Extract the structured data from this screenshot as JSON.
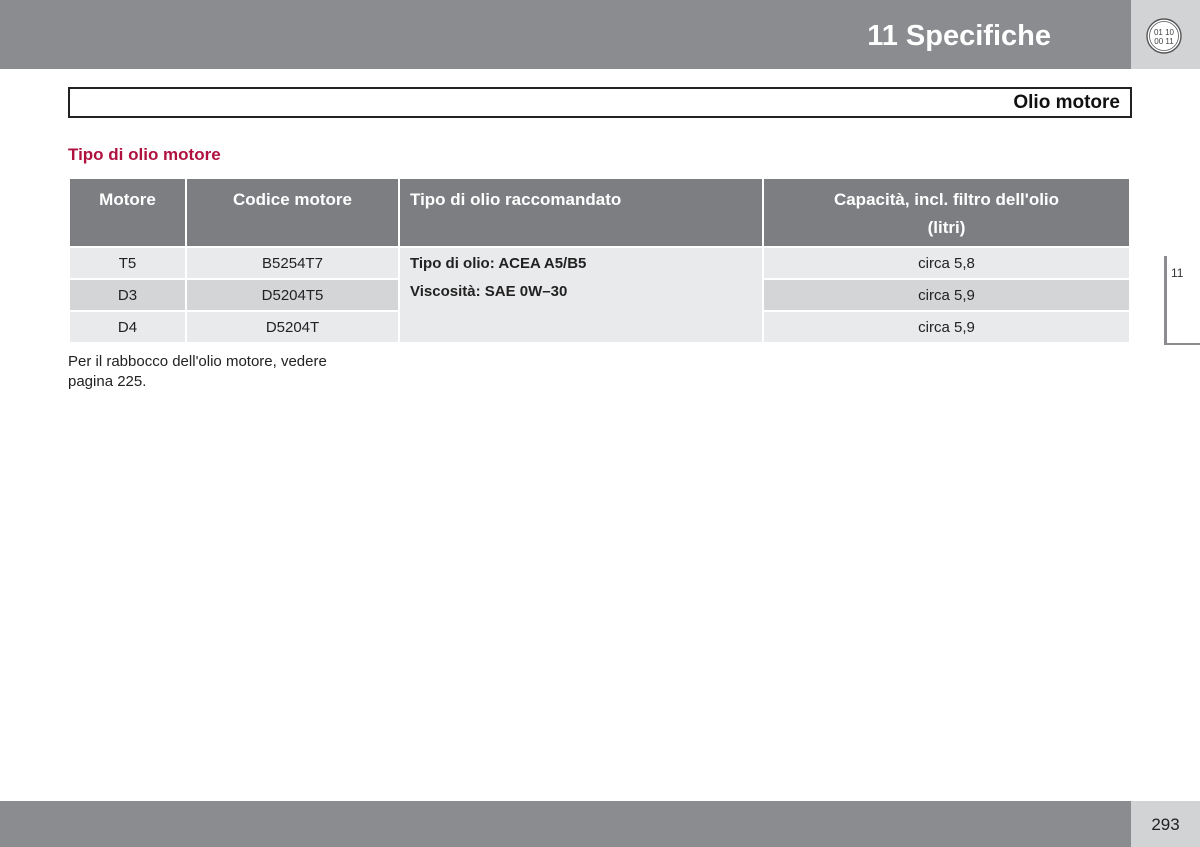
{
  "header": {
    "chapter_title": "11 Specifiche",
    "badge_icon": "chapter-index-icon",
    "badge_lines": [
      "01 10",
      "00 11"
    ]
  },
  "section": {
    "title": "Olio motore"
  },
  "sub_heading": "Tipo di olio motore",
  "table": {
    "headers": {
      "motore": "Motore",
      "codice": "Codice motore",
      "tipo": "Tipo di olio raccomandato",
      "capacita_line1": "Capacità, incl. filtro dell'olio",
      "capacita_line2": "(litri)"
    },
    "oil_type": "Tipo di olio: ACEA A5/B5",
    "viscosity": "Viscosità: SAE 0W–30",
    "rows": [
      {
        "motore": "T5",
        "codice": "B5254T7",
        "capacita": "circa 5,8"
      },
      {
        "motore": "D3",
        "codice": "D5204T5",
        "capacita": "circa 5,9"
      },
      {
        "motore": "D4",
        "codice": "D5204T",
        "capacita": "circa 5,9"
      }
    ]
  },
  "note": "Per il rabbocco dell'olio motore, vedere pagina 225.",
  "side_tab": "11",
  "page_number": "293",
  "colors": {
    "header_gray": "#8a8c8f",
    "table_header": "#7c7e81",
    "accent_red": "#b0123f"
  }
}
